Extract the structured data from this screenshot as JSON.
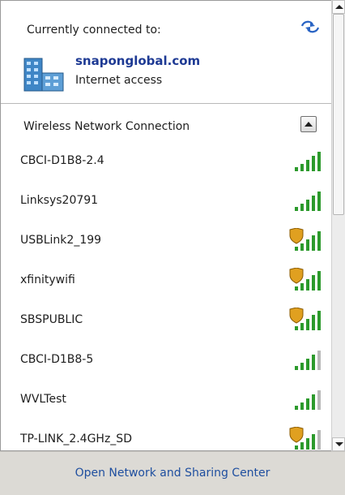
{
  "connected": {
    "heading": "Currently connected to:",
    "network_name": "snaponglobal.com",
    "network_status": "Internet access",
    "refresh_icon": "refresh-arrows-icon"
  },
  "wireless_section": {
    "title": "Wireless Network Connection",
    "collapse_icon": "collapse-up-icon"
  },
  "networks": [
    {
      "name": "CBCI-D1B8-2.4",
      "bars": 5,
      "secured": false
    },
    {
      "name": "Linksys20791",
      "bars": 5,
      "secured": false
    },
    {
      "name": "USBLink2_199",
      "bars": 5,
      "secured": true
    },
    {
      "name": "xfinitywifi",
      "bars": 5,
      "secured": true
    },
    {
      "name": "SBSPUBLIC",
      "bars": 5,
      "secured": true
    },
    {
      "name": "CBCI-D1B8-5",
      "bars": 4,
      "secured": false
    },
    {
      "name": "WVLTest",
      "bars": 4,
      "secured": false
    },
    {
      "name": "TP-LINK_2.4GHz_SD",
      "bars": 4,
      "secured": true
    }
  ],
  "footer": {
    "link_text": "Open Network and Sharing Center"
  },
  "colors": {
    "signal_active": "#2c9a2c",
    "signal_inactive": "#b8b8b8",
    "shield": "#e0a020",
    "link": "#1e4e9f"
  }
}
